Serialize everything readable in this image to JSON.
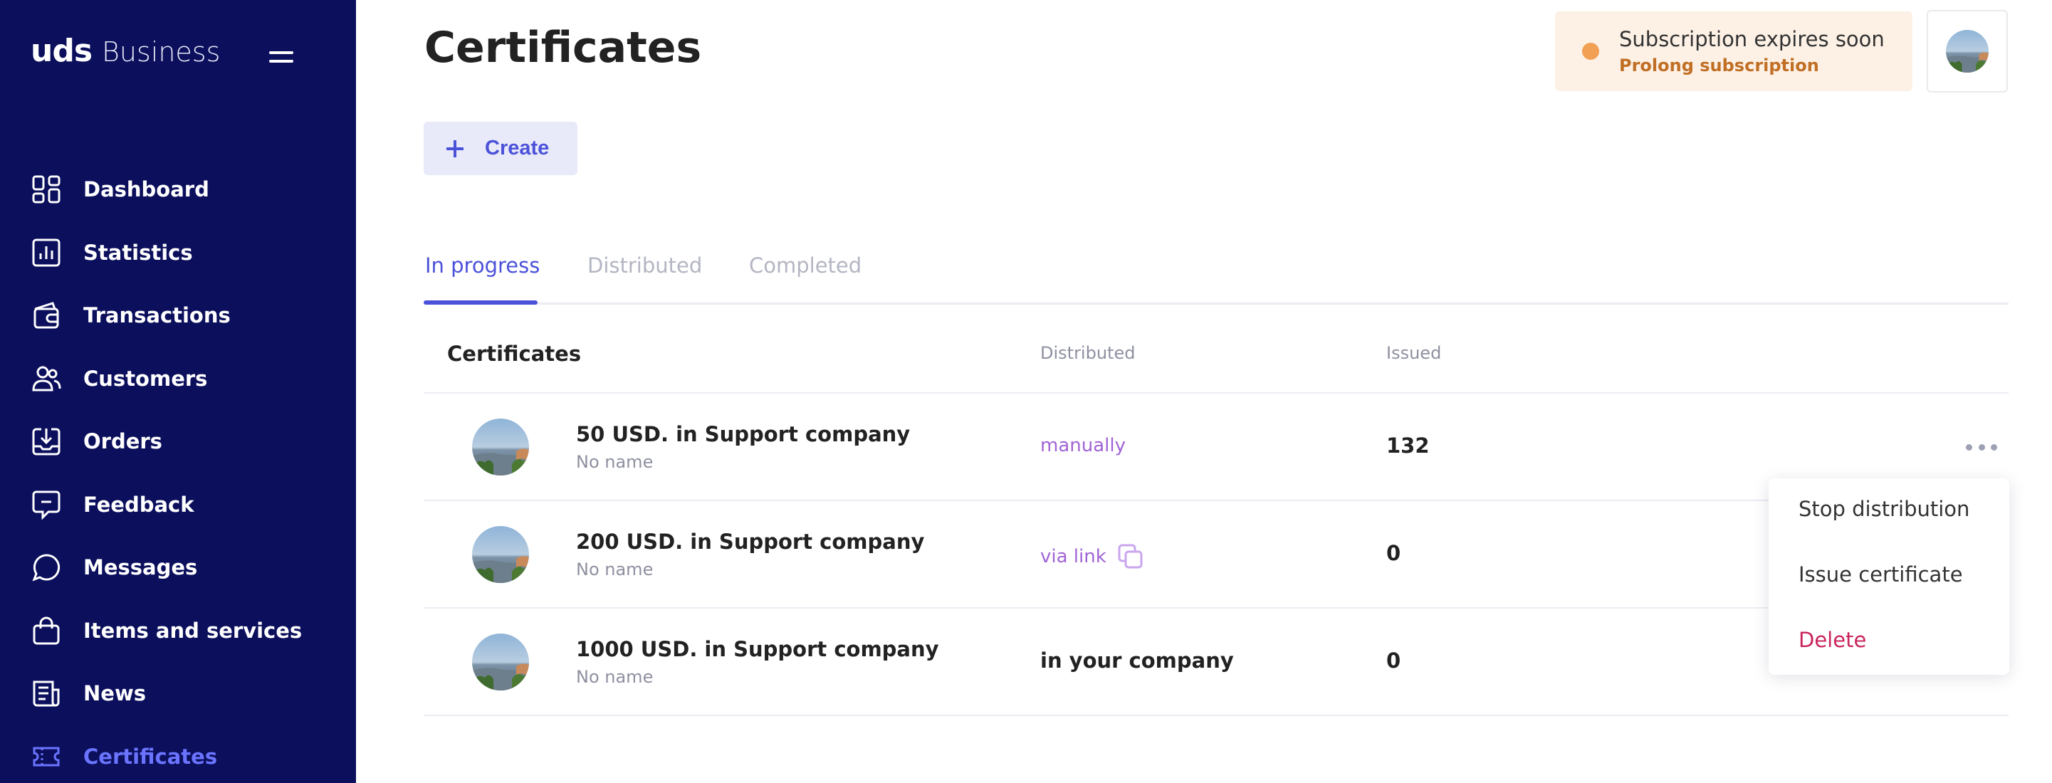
{
  "brand": {
    "name": "uds",
    "product": "Business"
  },
  "sidebar": {
    "items": [
      {
        "label": "Dashboard",
        "icon": "dashboard-icon"
      },
      {
        "label": "Statistics",
        "icon": "statistics-icon"
      },
      {
        "label": "Transactions",
        "icon": "transactions-icon"
      },
      {
        "label": "Customers",
        "icon": "customers-icon"
      },
      {
        "label": "Orders",
        "icon": "orders-icon"
      },
      {
        "label": "Feedback",
        "icon": "feedback-icon"
      },
      {
        "label": "Messages",
        "icon": "messages-icon"
      },
      {
        "label": "Items and services",
        "icon": "bag-icon"
      },
      {
        "label": "News",
        "icon": "news-icon"
      },
      {
        "label": "Certificates",
        "icon": "ticket-icon",
        "active": true
      }
    ]
  },
  "header": {
    "title": "Certificates",
    "subscription": {
      "title": "Subscription expires soon",
      "link": "Prolong subscription"
    }
  },
  "toolbar": {
    "create_label": "Create"
  },
  "tabs": [
    {
      "label": "In progress",
      "active": true
    },
    {
      "label": "Distributed"
    },
    {
      "label": "Completed"
    }
  ],
  "table": {
    "columns": [
      "Certificates",
      "Distributed",
      "Issued"
    ],
    "rows": [
      {
        "name": "50 USD. in Support company",
        "subtitle": "No name",
        "distributed": "manually",
        "issued": "132"
      },
      {
        "name": "200 USD. in Support company",
        "subtitle": "No name",
        "distributed": "via link",
        "issued": "0"
      },
      {
        "name": "1000 USD. in Support company",
        "subtitle": "No name",
        "distributed": "in your company",
        "issued": "0"
      }
    ]
  },
  "menu": {
    "items": [
      "Stop distribution",
      "Issue certificate",
      "Delete"
    ]
  },
  "colors": {
    "sidebar_bg": "#0b0f5c",
    "accent": "#4b52d9",
    "active_nav": "#6b74ff",
    "link_purple": "#a064d6",
    "warning": "#f2a053",
    "danger": "#c9245c"
  }
}
